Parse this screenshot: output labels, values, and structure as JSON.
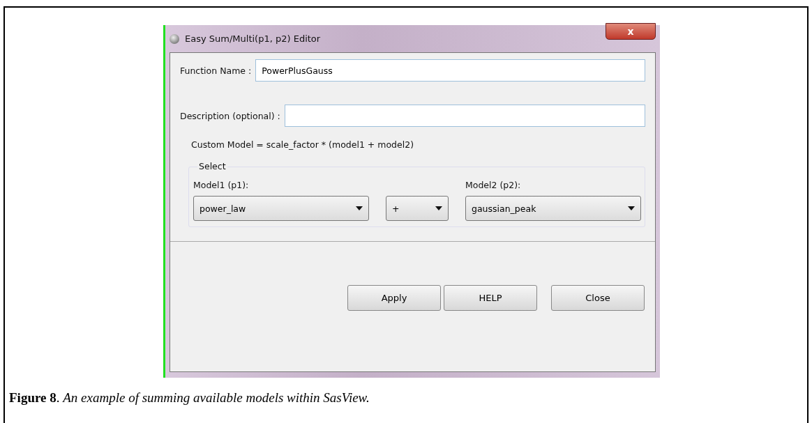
{
  "window": {
    "title": "Easy Sum/Multi(p1, p2) Editor",
    "close_label": "x"
  },
  "function_name": {
    "label": "Function Name :",
    "value": "PowerPlusGauss"
  },
  "description": {
    "label": "Description (optional) :"
  },
  "formula": "Custom Model = scale_factor * (model1 + model2)",
  "select": {
    "legend": "Select",
    "model1_label": "Model1 (p1):",
    "model2_label": "Model2 (p2):",
    "model1": "power_law",
    "operator": "+",
    "model2": "gaussian_peak"
  },
  "buttons": [
    "Apply",
    "HELP",
    "Close"
  ],
  "caption": "**Figure 8**. *An example of summing available models within SasView.*"
}
